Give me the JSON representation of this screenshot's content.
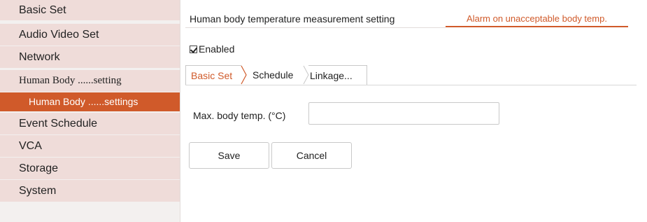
{
  "sidebar": {
    "items": [
      {
        "label": "Basic Set"
      },
      {
        "label": "Audio Video Set"
      },
      {
        "label": "Network"
      },
      {
        "label": "Human Body ......setting"
      },
      {
        "label": "Event Schedule"
      },
      {
        "label": "VCA"
      },
      {
        "label": "Storage"
      },
      {
        "label": "System"
      }
    ],
    "active_sub": "Human Body ......settings"
  },
  "header": {
    "title": "Human body temperature measurement setting",
    "tab": "Alarm on unacceptable body temp."
  },
  "enabled": {
    "label": "Enabled",
    "checked": true
  },
  "subtabs": [
    {
      "label": "Basic Set",
      "active": true
    },
    {
      "label": "Schedule"
    },
    {
      "label": "Linkage..."
    }
  ],
  "form": {
    "max_temp_label": "Max. body temp. (°C)",
    "max_temp_value": ""
  },
  "buttons": {
    "save": "Save",
    "cancel": "Cancel"
  },
  "colors": {
    "accent": "#d05a2a",
    "sidebar_item_bg": "#efdcd9",
    "sidebar_bg": "#f3f0ef"
  }
}
